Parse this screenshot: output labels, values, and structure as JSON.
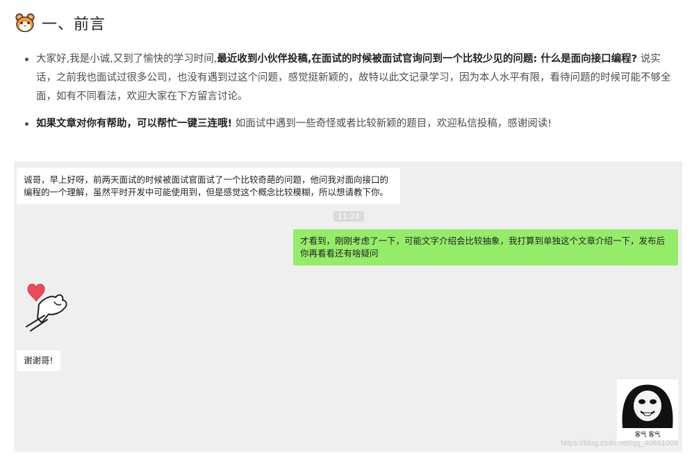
{
  "section": {
    "icon": "hamster-emoji-icon",
    "title": "一、前言"
  },
  "bullets": {
    "item1": {
      "plain1": "大家好,我是小诚,又到了愉快的学习时间,",
      "bold": "最近收到小伙伴投稿,在面试的时候被面试官询问到一个比较少见的问题: 什么是面向接口编程?",
      "plain2": " 说实话，之前我也面试过很多公司，也没有遇到过这个问题，感觉挺新颖的，故特以此文记录学习，因为本人水平有限，看待问题的时候可能不够全面，如有不同看法，欢迎大家在下方留言讨论。"
    },
    "item2": {
      "bold": "如果文章对你有帮助，可以帮忙一键三连哦!",
      "plain": " 如面试中遇到一些奇怪或者比较新颖的题目，欢迎私信投稿，感谢阅读!"
    }
  },
  "chat": {
    "msg1": "诚哥，早上好呀，前两天面试的时候被面试官面试了一个比较奇葩的问题，他问我对面向接口的编程的一个理解，虽然平时开发中可能使用到，但是感觉这个概念比较模糊，所以想请教下你。",
    "time": "11:24",
    "msg2": "才看到，刚刚考虑了一下，可能文字介绍会比较抽象，我打算到单独这个文章介绍一下，发布后你再看看还有啥疑问",
    "sticker1": "heart-hand-sticker",
    "msg3": "谢谢哥!",
    "sticker2": "panda-face-sticker",
    "sticker2_caption": "客气 客气",
    "watermark": "https://blog.csdn.net/qq_40891009"
  },
  "colors": {
    "chat_bg": "#efefef",
    "bubble_right": "#95ec69",
    "bubble_left": "#ffffff"
  }
}
